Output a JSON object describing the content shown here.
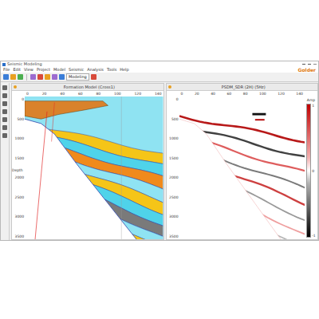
{
  "window": {
    "title": "Seismic Modeling"
  },
  "menu": [
    "File",
    "Edit",
    "View",
    "Project",
    "Model",
    "Seismic",
    "Analysis",
    "Tools",
    "Help"
  ],
  "logo": "Golder",
  "toolbar": {
    "mode": "Modeling"
  },
  "left_panel": {
    "title": "Formation Model (Cross1)",
    "x_ticks": [
      "0",
      "20",
      "40",
      "60",
      "80",
      "100",
      "120",
      "140"
    ],
    "y_ticks": [
      "0",
      "500",
      "1000",
      "1500",
      "2000",
      "2500",
      "3000",
      "3500"
    ],
    "y_label": "Depth",
    "layers": [
      {
        "kind": "slab",
        "color": "#d9822b"
      },
      {
        "kind": "band",
        "color": "#f5c518"
      },
      {
        "kind": "band",
        "color": "#4fd3ea"
      },
      {
        "kind": "band",
        "color": "#f08a1c"
      },
      {
        "kind": "band",
        "color": "#8fe3f2"
      },
      {
        "kind": "band",
        "color": "#f5c518"
      },
      {
        "kind": "band",
        "color": "#4fd3ea"
      },
      {
        "kind": "band",
        "color": "#7a7a7a"
      },
      {
        "kind": "band",
        "color": "#8fe3f2"
      },
      {
        "kind": "band",
        "color": "#f5c518"
      },
      {
        "kind": "band",
        "color": "#4fd3ea"
      },
      {
        "kind": "band",
        "color": "#5c5c5c"
      },
      {
        "kind": "band",
        "color": "#8fe3f2"
      },
      {
        "kind": "band",
        "color": "#9a9a9a"
      },
      {
        "kind": "band",
        "color": "#4fd3ea"
      },
      {
        "kind": "band",
        "color": "#6e6e6e"
      },
      {
        "kind": "band",
        "color": "#8fe3f2"
      }
    ]
  },
  "right_panel": {
    "title": "PSDM_SDR (2H) (5Hz)",
    "x_ticks": [
      "0",
      "20",
      "40",
      "60",
      "80",
      "100",
      "120",
      "140"
    ],
    "y_ticks": [
      "0",
      "500",
      "1000",
      "1500",
      "2000",
      "2500",
      "3000",
      "3500"
    ],
    "colorbar": {
      "title": "Amp",
      "ticks": [
        "1",
        "0",
        "-1"
      ]
    },
    "reflectors": [
      {
        "color": "#b00000",
        "level": 0.9
      },
      {
        "color": "#111111",
        "level": 0.8
      },
      {
        "color": "#d01818",
        "level": 0.7
      },
      {
        "color": "#222222",
        "level": 0.6
      },
      {
        "color": "#c01010",
        "level": 0.8
      },
      {
        "color": "#333333",
        "level": 0.5
      },
      {
        "color": "#e04040",
        "level": 0.5
      },
      {
        "color": "#444444",
        "level": 0.4
      },
      {
        "color": "#e06060",
        "level": 0.35
      },
      {
        "color": "#777777",
        "level": 0.3
      },
      {
        "color": "#f08080",
        "level": 0.25
      },
      {
        "color": "#999999",
        "level": 0.2
      }
    ]
  }
}
